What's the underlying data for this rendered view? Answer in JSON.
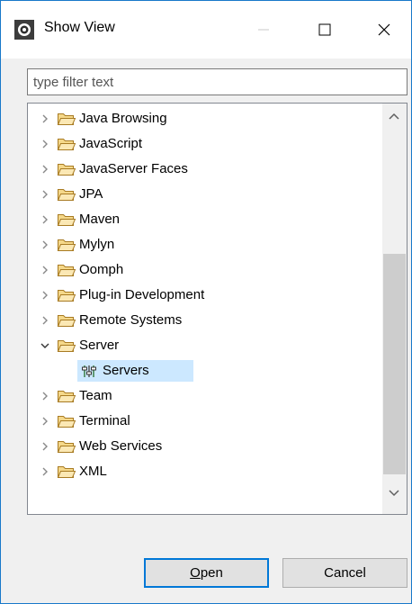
{
  "window": {
    "title": "Show View"
  },
  "filter": {
    "placeholder": "type filter text",
    "value": ""
  },
  "tree": {
    "items": [
      {
        "label": "Java Browsing",
        "expanded": false,
        "icon": "folder-icon"
      },
      {
        "label": "JavaScript",
        "expanded": false,
        "icon": "folder-icon"
      },
      {
        "label": "JavaServer Faces",
        "expanded": false,
        "icon": "folder-icon"
      },
      {
        "label": "JPA",
        "expanded": false,
        "icon": "folder-icon"
      },
      {
        "label": "Maven",
        "expanded": false,
        "icon": "folder-icon"
      },
      {
        "label": "Mylyn",
        "expanded": false,
        "icon": "folder-icon"
      },
      {
        "label": "Oomph",
        "expanded": false,
        "icon": "folder-icon"
      },
      {
        "label": "Plug-in Development",
        "expanded": false,
        "icon": "folder-icon"
      },
      {
        "label": "Remote Systems",
        "expanded": false,
        "icon": "folder-icon"
      },
      {
        "label": "Server",
        "expanded": true,
        "icon": "folder-icon"
      },
      {
        "label": "Servers",
        "child": true,
        "selected": true,
        "icon": "servers-icon"
      },
      {
        "label": "Team",
        "expanded": false,
        "icon": "folder-icon"
      },
      {
        "label": "Terminal",
        "expanded": false,
        "icon": "folder-icon"
      },
      {
        "label": "Web Services",
        "expanded": false,
        "icon": "folder-icon"
      },
      {
        "label": "XML",
        "expanded": false,
        "icon": "folder-icon"
      }
    ]
  },
  "buttons": {
    "open_mnemonic": "O",
    "open_rest": "pen",
    "cancel": "Cancel"
  },
  "colors": {
    "selection": "#cce8ff",
    "folder": "#dcb35c",
    "accent": "#0078d7"
  }
}
